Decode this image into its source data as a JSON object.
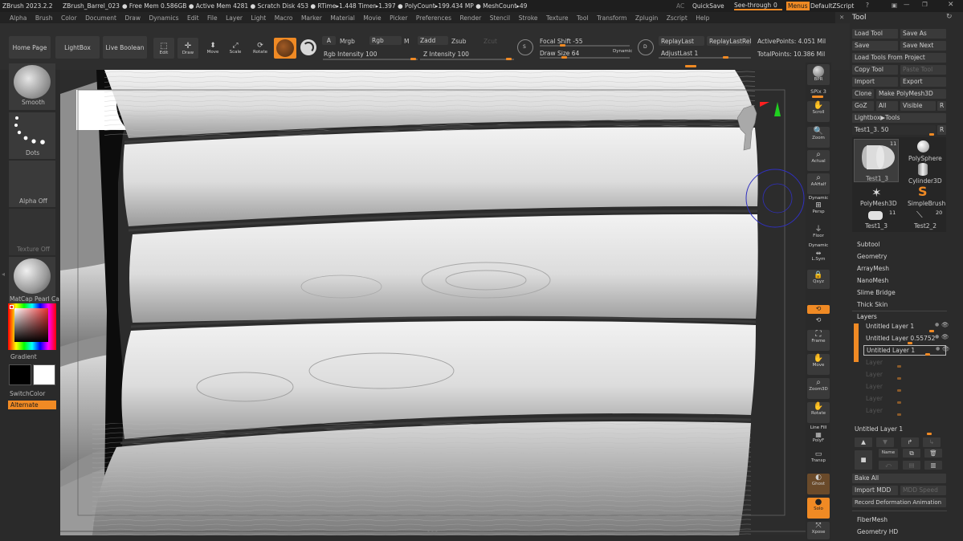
{
  "titlebar": {
    "app": "ZBrush 2023.2.2",
    "document": "ZBrush_Barrel_023",
    "stats": "● Free Mem 0.586GB ● Active Mem 4281 ● Scratch Disk 453 ● RTime▸1.448 Timer▸1.397 ● PolyCount▸199.434 MP ● MeshCount▸49",
    "ac": "AC",
    "quicksave": "QuickSave",
    "see_through_label": "See-through",
    "see_through_value": "0",
    "menus": "Menus",
    "default_zscript": "DefaultZScript"
  },
  "menus": [
    "Alpha",
    "Brush",
    "Color",
    "Document",
    "Draw",
    "Dynamics",
    "Edit",
    "File",
    "Layer",
    "Light",
    "Macro",
    "Marker",
    "Material",
    "Movie",
    "Picker",
    "Preferences",
    "Render",
    "Stencil",
    "Stroke",
    "Texture",
    "Tool",
    "Transform",
    "Zplugin",
    "Zscript",
    "Help"
  ],
  "shelf": {
    "home_page": "Home Page",
    "lightbox": "LightBox",
    "live_boolean": "Live Boolean",
    "edit": "Edit",
    "draw": "Draw",
    "move": "Move",
    "scale": "Scale",
    "rotate": "Rotate",
    "a": "A",
    "mrgb": "Mrgb",
    "rgb": "Rgb",
    "m": "M",
    "rgb_intensity": "Rgb Intensity 100",
    "zadd": "Zadd",
    "zsub": "Zsub",
    "zcut": "Zcut",
    "z_intensity": "Z Intensity 100",
    "focal_shift": "Focal Shift -55",
    "draw_size": "Draw Size 64",
    "dynamic": "Dynamic",
    "replay_last": "ReplayLast",
    "replay_last_rel": "ReplayLastRel",
    "adjust_last": "AdjustLast 1",
    "active_points": "ActivePoints: 4.051 Mil",
    "total_points": "TotalPoints: 10.386 Mil"
  },
  "left_tray": {
    "brush": "Smooth",
    "stroke": "Dots",
    "alpha": "Alpha Off",
    "texture": "Texture Off",
    "material": "MatCap Pearl Ca",
    "gradient": "Gradient",
    "switch_color": "SwitchColor",
    "alternate": "Alternate"
  },
  "right_shelf": [
    {
      "label": "BPR"
    },
    {
      "label": "SPix 3"
    },
    {
      "label": "Scroll"
    },
    {
      "label": "Zoom"
    },
    {
      "label": "Actual"
    },
    {
      "label": "AAHalf"
    },
    {
      "label": "Persp"
    },
    {
      "label": "Floor"
    },
    {
      "label": "L.Sym"
    },
    {
      "label": "Qxyz"
    },
    {
      "label": "Frame"
    },
    {
      "label": "Move"
    },
    {
      "label": "Zoom3D"
    },
    {
      "label": "Rotate"
    },
    {
      "label": "PolyF"
    },
    {
      "label": "Transp"
    },
    {
      "label": "Ghost"
    },
    {
      "label": "Solo"
    },
    {
      "label": "Xpose"
    }
  ],
  "right_shelf_extra": {
    "dynamic": "Dynamic",
    "line_fill": "Line Fill"
  },
  "tool": {
    "title": "Tool",
    "load_tool": "Load Tool",
    "save_as": "Save As",
    "save": "Save",
    "save_next": "Save Next",
    "load_from_project": "Load Tools From Project",
    "copy_tool": "Copy Tool",
    "paste_tool": "Paste Tool",
    "import": "Import",
    "export": "Export",
    "clone": "Clone",
    "make_polymesh": "Make PolyMesh3D",
    "goz": "GoZ",
    "all": "All",
    "visible": "Visible",
    "r": "R",
    "lightbox_tools": "Lightbox▶Tools",
    "current": "Test1_3. 50",
    "thumbs": [
      {
        "name": "Test1_3",
        "count": "11"
      },
      {
        "name": "PolySphere",
        "count": ""
      },
      {
        "name": "Cylinder3D",
        "count": ""
      },
      {
        "name": "PolyMesh3D",
        "count": ""
      },
      {
        "name": "SimpleBrush",
        "count": ""
      },
      {
        "name": "Test1_3",
        "count": "11"
      },
      {
        "name": "Test2_2",
        "count": "20"
      }
    ],
    "sections": [
      "Subtool",
      "Geometry",
      "ArrayMesh",
      "NanoMesh",
      "Slime Bridge",
      "Thick Skin"
    ],
    "layers_title": "Layers",
    "layers": [
      {
        "name": "Untitled Layer 1"
      },
      {
        "name": "Untitled Layer 0.55752"
      },
      {
        "name": "Untitled Layer 1"
      }
    ],
    "empty_layers": [
      "Layer",
      "Layer",
      "Layer",
      "Layer",
      "Layer"
    ],
    "current_layer": "Untitled Layer 1",
    "name_btn": "Name",
    "bake_all": "Bake All",
    "import_mdd": "Import MDD",
    "mdd_speed": "MDD Speed",
    "record_deformation": "Record Deformation Animation",
    "fibermesh": "FiberMesh",
    "geometry_hd": "Geometry HD"
  }
}
